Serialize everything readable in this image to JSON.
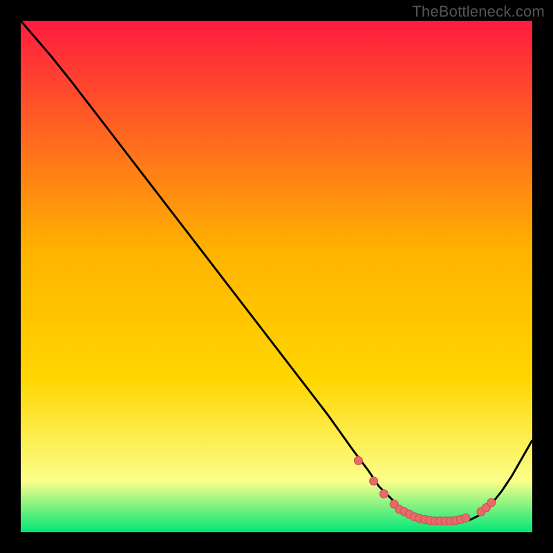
{
  "watermark": "TheBottleneck.com",
  "colors": {
    "bg_black": "#000000",
    "gradient_top": "#ff1b3f",
    "gradient_mid": "#ffd600",
    "gradient_low": "#fbff8a",
    "gradient_bottom": "#00e676",
    "curve": "#000000",
    "dot_fill": "#e86a6a",
    "dot_stroke": "#c94d4d"
  },
  "chart_data": {
    "type": "line",
    "title": "",
    "xlabel": "",
    "ylabel": "",
    "xlim": [
      0,
      100
    ],
    "ylim": [
      0,
      100
    ],
    "series": [
      {
        "name": "bottleneck-curve",
        "x": [
          0,
          6,
          10,
          20,
          30,
          40,
          50,
          60,
          65,
          68,
          70,
          72,
          74,
          76,
          78,
          80,
          82,
          84,
          86,
          88,
          90,
          92,
          94,
          96,
          100
        ],
        "y": [
          100,
          93,
          88,
          75,
          62,
          49,
          36,
          23,
          16,
          12,
          9,
          7,
          5,
          3.5,
          2.5,
          2,
          2,
          2,
          2,
          2.5,
          3.5,
          5.5,
          8,
          11,
          18
        ]
      }
    ],
    "dots": {
      "name": "highlighted-points",
      "x": [
        66,
        69,
        71,
        73,
        74,
        75,
        76,
        77,
        78,
        79,
        80,
        81,
        82,
        83,
        84,
        85,
        86,
        87,
        90,
        91,
        92
      ],
      "y": [
        14,
        10,
        7.5,
        5.5,
        4.5,
        4,
        3.5,
        3,
        2.7,
        2.5,
        2.3,
        2.2,
        2.2,
        2.2,
        2.2,
        2.3,
        2.5,
        2.8,
        4,
        4.8,
        5.8
      ]
    }
  }
}
